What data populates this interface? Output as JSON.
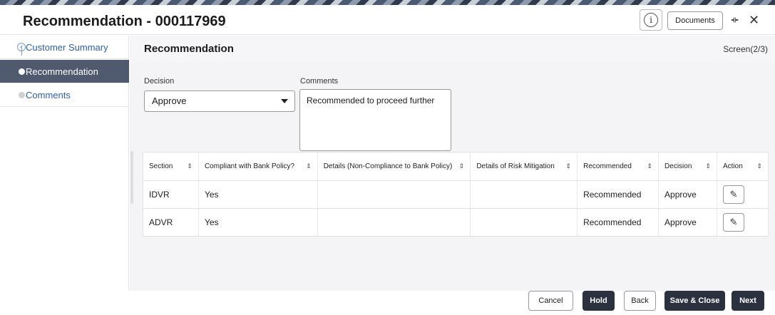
{
  "window": {
    "title": "Recommendation - 000117969",
    "info_icon": "info-icon",
    "documents_label": "Documents",
    "collapse_icon": "collapse-icon",
    "close_icon": "close-icon"
  },
  "sidebar": {
    "items": [
      {
        "label": "Customer Summary",
        "state": "completed"
      },
      {
        "label": "Recommendation",
        "state": "active"
      },
      {
        "label": "Comments",
        "state": "pending"
      }
    ]
  },
  "main": {
    "title": "Recommendation",
    "screen_indicator": "Screen(2/3)",
    "decision": {
      "label": "Decision",
      "value": "Approve"
    },
    "comments": {
      "label": "Comments",
      "value": "Recommended to proceed further"
    },
    "table": {
      "headers": [
        "Section",
        "Compliant with Bank Policy?",
        "Details (Non-Compliance to Bank Policy)",
        "Details of Risk Mitigation",
        "Recommended",
        "Decision",
        "Action"
      ],
      "rows": [
        [
          "IDVR",
          "Yes",
          "",
          "",
          "Recommended",
          "Approve"
        ],
        [
          "ADVR",
          "Yes",
          "",
          "",
          "Recommended",
          "Approve"
        ]
      ]
    }
  },
  "footer": {
    "cancel": "Cancel",
    "hold": "Hold",
    "back": "Back",
    "save_close": "Save & Close",
    "next": "Next"
  },
  "colors": {
    "sidebar_active_bg": "#505a6e",
    "primary_button": "#2c3140",
    "link_text": "#2c5fa8"
  }
}
